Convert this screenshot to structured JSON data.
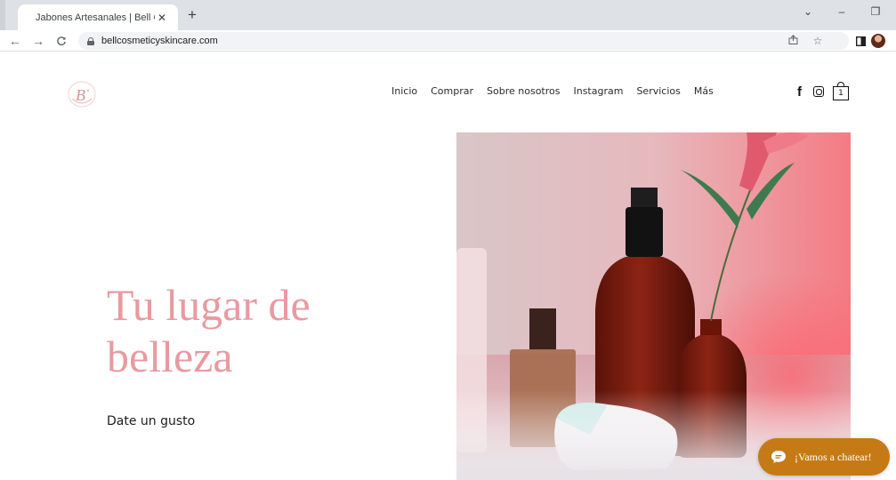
{
  "browser": {
    "tab_title": "Jabones Artesanales | Bell Cosme",
    "tab_close": "✕",
    "new_tab": "+",
    "url": "bellcosmeticyskincare.com",
    "window_controls": {
      "minimize": "–",
      "dropdown": "⌄",
      "restore": "❐"
    },
    "icons": [
      "back-arrow-icon",
      "forward-arrow-icon",
      "reload-icon",
      "lock-icon",
      "share-icon",
      "star-icon",
      "side-panel-icon",
      "profile-avatar"
    ]
  },
  "site": {
    "logo_letters": "B",
    "nav": {
      "items": [
        "Inicio",
        "Comprar",
        "Sobre nosotros",
        "Instagram",
        "Servicios",
        "Más"
      ]
    },
    "social": {
      "facebook": "f",
      "instagram": "instagram-icon"
    },
    "cart": {
      "count": "1"
    },
    "hero": {
      "title_line1": "Tu lugar de",
      "title_line2": "belleza",
      "subtitle": "Date un gusto"
    },
    "chat": {
      "label": "¡Vamos a chatear!"
    },
    "colors": {
      "accent_pink": "#e89aa0",
      "chat_button": "#c67a15",
      "text_dark": "#1c1c1c"
    }
  }
}
